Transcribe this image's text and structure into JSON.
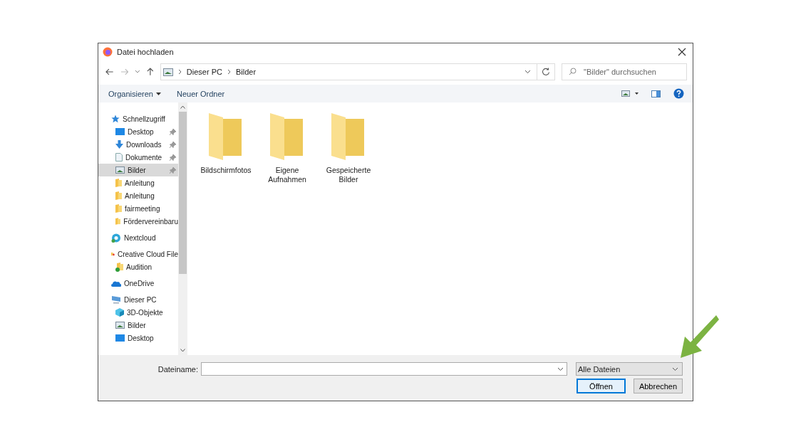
{
  "window": {
    "title": "Datei hochladen"
  },
  "address": {
    "path": [
      {
        "label": "Dieser PC"
      },
      {
        "label": "Bilder"
      }
    ]
  },
  "search": {
    "placeholder": "\"Bilder\" durchsuchen"
  },
  "toolbar": {
    "organize": "Organisieren",
    "new_folder": "Neuer Ordner"
  },
  "sidebar": {
    "items": [
      {
        "label": "Schnellzugriff",
        "kind": "star",
        "selected": false,
        "children": [
          {
            "label": "Desktop",
            "kind": "desktop",
            "pinned": true,
            "selected": false
          },
          {
            "label": "Downloads",
            "kind": "download",
            "pinned": true,
            "selected": false
          },
          {
            "label": "Dokumente",
            "kind": "document",
            "pinned": true,
            "selected": false
          },
          {
            "label": "Bilder",
            "kind": "pictures",
            "pinned": true,
            "selected": true
          },
          {
            "label": "Anleitung",
            "kind": "folder",
            "pinned": false,
            "selected": false
          },
          {
            "label": "Anleitung",
            "kind": "folder",
            "pinned": false,
            "selected": false
          },
          {
            "label": "fairmeeting",
            "kind": "folder",
            "pinned": false,
            "selected": false
          },
          {
            "label": "Fördervereinbaru",
            "kind": "folder",
            "pinned": false,
            "selected": false
          }
        ]
      },
      {
        "label": "Nextcloud",
        "kind": "cloud-sync",
        "selected": false
      },
      {
        "label": "Creative Cloud File",
        "kind": "cc-folder",
        "selected": false,
        "children": [
          {
            "label": "Audition",
            "kind": "folder-check",
            "pinned": false,
            "selected": false
          }
        ]
      },
      {
        "label": "OneDrive",
        "kind": "cloud",
        "selected": false
      },
      {
        "label": "Dieser PC",
        "kind": "pc",
        "selected": false,
        "children": [
          {
            "label": "3D-Objekte",
            "kind": "cube",
            "pinned": false,
            "selected": false
          },
          {
            "label": "Bilder",
            "kind": "pictures",
            "pinned": false,
            "selected": false
          },
          {
            "label": "Desktop",
            "kind": "desktop",
            "pinned": false,
            "selected": false
          }
        ]
      }
    ]
  },
  "files": [
    {
      "name": "Bildschirmfotos"
    },
    {
      "name": "Eigene Aufnahmen"
    },
    {
      "name": "Gespeicherte Bilder"
    }
  ],
  "filename": {
    "label": "Dateiname:"
  },
  "filter": {
    "value": "Alle Dateien"
  },
  "buttons": [
    {
      "label": "Öffnen",
      "kind": "primary"
    },
    {
      "label": "Abbrechen",
      "kind": "secondary"
    }
  ]
}
